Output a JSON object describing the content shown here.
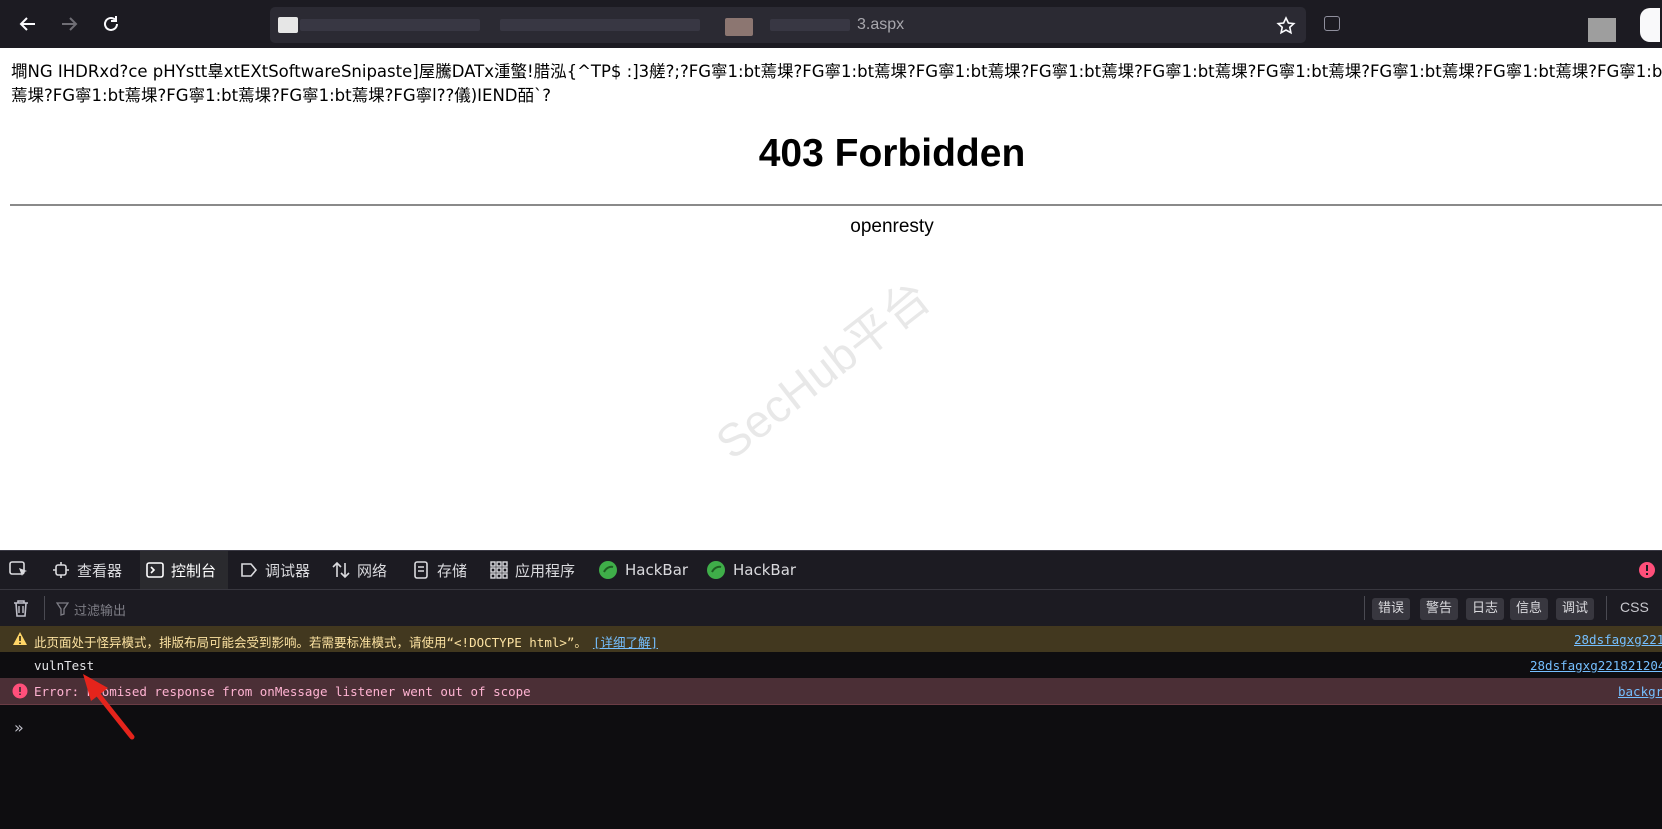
{
  "browser": {
    "url_visible": "3.aspx"
  },
  "page": {
    "garbled_text": "墹NG   IHDRxd?ce pHYstt辠xtEXtSoftwareSnipaste]屋騰DATx湩蟼!腊泓{^TP$ :]3艖?;?FG寧1:bt蔫堁?FG寧1:bt蔫堁?FG寧1:bt蔫堁?FG寧1:bt蔫堁?FG寧1:bt蔫堁?FG寧1:bt蔫堁?FG寧1:bt蔫堁?FG寧1:bt蔫堁?FG寧1:bt蔫堁?FG寧1:bt蔫堁?FG寧1:bt蔫堁?FG寧1:bt蔫堁?FG寧l??儀)IEND皕`?",
    "heading": "403 Forbidden",
    "server": "openresty",
    "watermark": "SecHub平台"
  },
  "devtools": {
    "tabs": [
      {
        "label": "查看器",
        "icon": "inspector-icon"
      },
      {
        "label": "控制台",
        "icon": "console-icon",
        "active": true
      },
      {
        "label": "调试器",
        "icon": "debugger-icon"
      },
      {
        "label": "网络",
        "icon": "network-icon"
      },
      {
        "label": "存储",
        "icon": "storage-icon"
      },
      {
        "label": "应用程序",
        "icon": "application-icon"
      },
      {
        "label": "HackBar",
        "icon": "hackbar-icon"
      },
      {
        "label": "HackBar",
        "icon": "hackbar-icon"
      }
    ],
    "filter_placeholder": "过滤输出",
    "levels": [
      "错误",
      "警告",
      "日志",
      "信息",
      "调试"
    ],
    "css_label": "CSS",
    "messages": [
      {
        "type": "warning",
        "text": "此页面处于怪异模式，排版布局可能会受到影响。若需要标准模式，请使用“<!DOCTYPE html>”。",
        "link": "[详细了解]",
        "source": "28dsfagxg221"
      },
      {
        "type": "log",
        "text": "vulnTest",
        "source": "28dsfagxg221821204"
      },
      {
        "type": "error",
        "text": "Error: Promised response from onMessage listener went out of scope",
        "source": "backgr"
      }
    ],
    "prompt_symbol": "»"
  },
  "colors": {
    "toolbar_bg": "#1c1b22",
    "devtools_bg": "#0e0d10",
    "warning_bg": "#42381f",
    "error_bg": "#4b2f36",
    "link": "#75bfff",
    "annotation_arrow": "#e5241c"
  }
}
